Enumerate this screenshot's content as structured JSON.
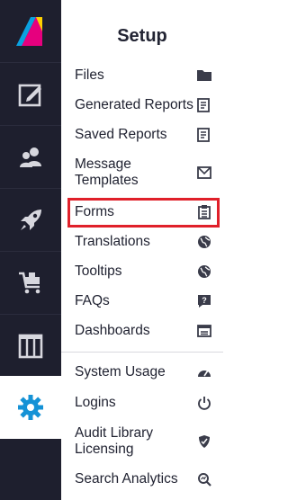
{
  "sidebar": {
    "logo": "brand-logo",
    "items": [
      {
        "name": "edit-icon"
      },
      {
        "name": "users-icon"
      },
      {
        "name": "rocket-icon"
      },
      {
        "name": "cart-icon"
      },
      {
        "name": "columns-icon"
      },
      {
        "name": "gear-icon",
        "active": true
      }
    ]
  },
  "panel": {
    "title": "Setup",
    "items": [
      {
        "label": "Files",
        "icon": "folder-icon"
      },
      {
        "label": "Generated Reports",
        "icon": "report-icon"
      },
      {
        "label": "Saved Reports",
        "icon": "report-icon"
      },
      {
        "label": "Message Templates",
        "icon": "mail-icon"
      },
      {
        "label": "Forms",
        "icon": "clipboard-icon"
      },
      {
        "label": "Translations",
        "icon": "globe-icon"
      },
      {
        "label": "Tooltips",
        "icon": "globe-icon"
      },
      {
        "label": "FAQs",
        "icon": "question-chat-icon"
      },
      {
        "label": "Dashboards",
        "icon": "dashboard-icon"
      },
      {
        "label": "System Usage",
        "icon": "gauge-icon"
      },
      {
        "label": "Logins",
        "icon": "power-icon"
      },
      {
        "label": "Audit Library Licensing",
        "icon": "shield-icon"
      },
      {
        "label": "Search Analytics",
        "icon": "search-analytics-icon"
      }
    ]
  },
  "colors": {
    "rail_bg": "#1e1f2e",
    "rail_icon": "#d7d7de",
    "active_icon": "#1592d6",
    "highlight": "#e0202a",
    "text": "#1f2130"
  }
}
